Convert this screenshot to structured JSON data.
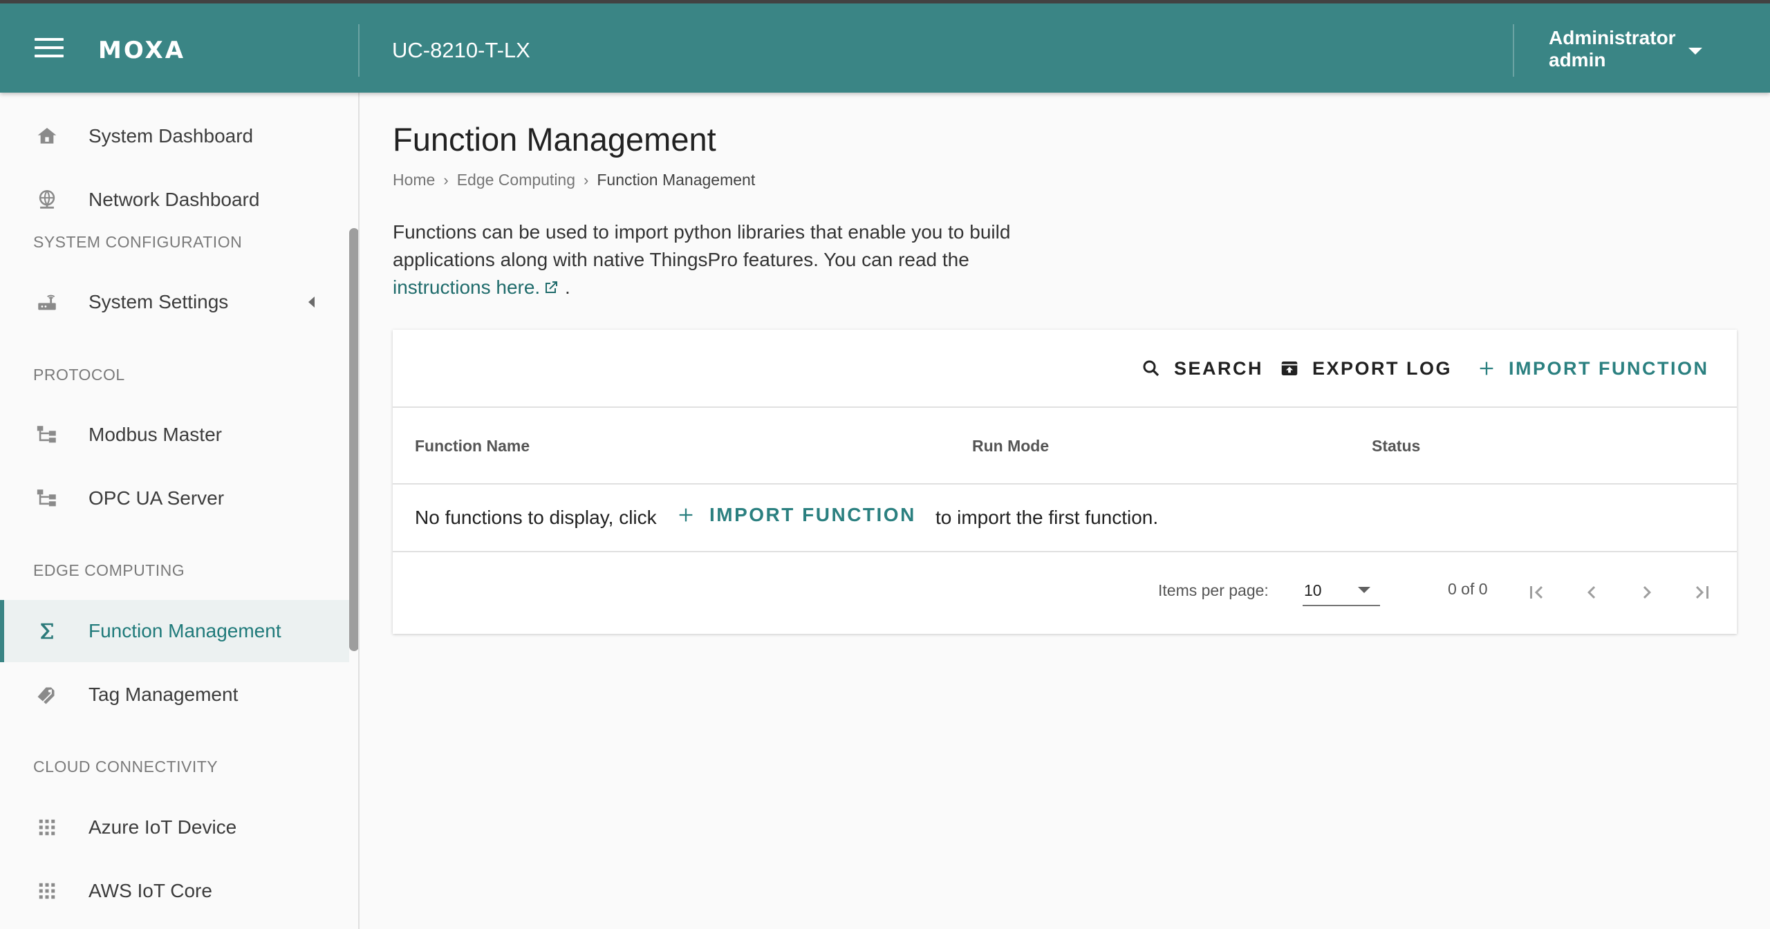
{
  "header": {
    "logo_text": "MOXA",
    "device_name": "UC-8210-T-LX",
    "user_role": "Administrator",
    "user_name": "admin"
  },
  "sidebar": {
    "items": [
      {
        "label": "System Dashboard",
        "icon": "home-icon"
      },
      {
        "label": "Network Dashboard",
        "icon": "globe-icon"
      },
      {
        "section": "SYSTEM CONFIGURATION"
      },
      {
        "label": "System Settings",
        "icon": "router-icon"
      },
      {
        "section": "PROTOCOL"
      },
      {
        "label": "Modbus Master",
        "icon": "tree-icon"
      },
      {
        "label": "OPC UA Server",
        "icon": "tree-icon"
      },
      {
        "section": "EDGE COMPUTING"
      },
      {
        "label": "Function Management",
        "icon": "sigma-icon",
        "active": true
      },
      {
        "label": "Tag Management",
        "icon": "tags-icon"
      },
      {
        "section": "CLOUD CONNECTIVITY"
      },
      {
        "label": "Azure IoT Device",
        "icon": "grid-icon"
      },
      {
        "label": "AWS IoT Core",
        "icon": "grid-icon"
      }
    ]
  },
  "main": {
    "title": "Function Management",
    "breadcrumb": [
      "Home",
      "Edge Computing",
      "Function Management"
    ],
    "description_text": "Functions can be used to import python libraries that enable you to build applications along with native ThingsPro features. You can read the",
    "description_link": "instructions here.",
    "description_end": ".",
    "toolbar": {
      "search_label": "SEARCH",
      "export_label": "EXPORT LOG",
      "import_label": "IMPORT FUNCTION"
    },
    "table": {
      "columns": [
        "Function Name",
        "Run Mode",
        "Status"
      ],
      "empty_prefix": "No functions to display, click",
      "empty_action": "IMPORT FUNCTION",
      "empty_suffix": "to import the first function."
    },
    "paginator": {
      "items_per_page_label": "Items per page:",
      "items_per_page_value": "10",
      "range_label": "0 of 0"
    }
  },
  "colors": {
    "header_bg": "#3a8585",
    "accent": "#2b8080",
    "active_bg": "#ecf1f1"
  }
}
